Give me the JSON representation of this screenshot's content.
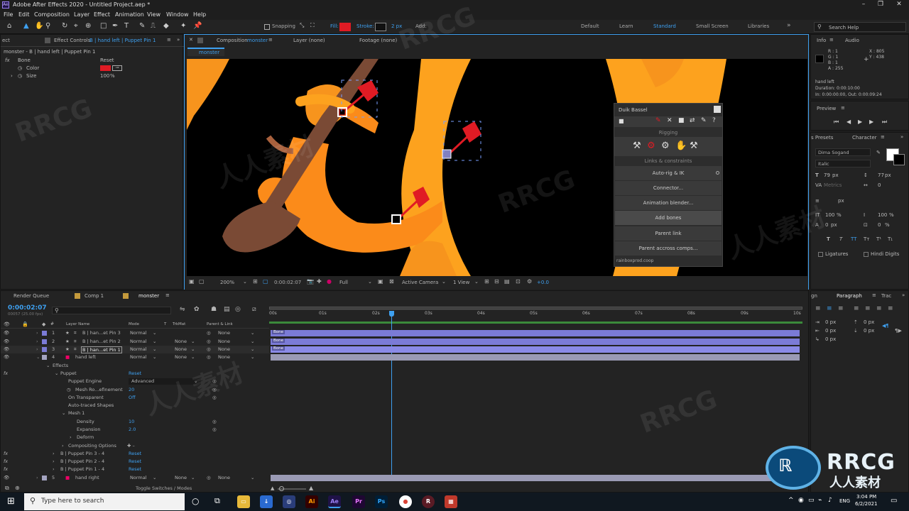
{
  "app": {
    "title": "Adobe After Effects 2020 - Untitled Project.aep *"
  },
  "menu": [
    "File",
    "Edit",
    "Composition",
    "Layer",
    "Effect",
    "Animation",
    "View",
    "Window",
    "Help"
  ],
  "toolbar": {
    "snapping": "Snapping",
    "fill": "Fill:",
    "stroke": "Stroke:",
    "stroke_px": "2 px",
    "add": "Add:",
    "workspaces": [
      "Default",
      "Learn",
      "Standard",
      "Small Screen",
      "Libraries"
    ],
    "search": "Search Help",
    "fill_color": "#e01b24"
  },
  "effect_controls": {
    "tab_prefix": "ect",
    "tab": "Effect Controls",
    "tab_layer": "B | hand left | Puppet Pin 1",
    "path": "monster - B | hand left | Puppet Pin 1",
    "fx": "fx",
    "effect_name": "Bone",
    "reset": "Reset",
    "color_label": "Color",
    "size_label": "Size",
    "size_value": "100",
    "size_unit": "%",
    "bone_color": "#e01b24"
  },
  "comp_panel": {
    "tab": "Composition",
    "tab_name": "monster",
    "layer_tab": "Layer (none)",
    "footage_tab": "Footage (none)",
    "crumb": "monster",
    "zoom": "200%",
    "time": "0:00:02:07",
    "resolution": "Full",
    "camera": "Active Camera",
    "view": "1 View",
    "exposure": "+0.0"
  },
  "duik": {
    "title": "Duik Bassel",
    "section1": "Rigging",
    "section2": "Links & constraints",
    "buttons": [
      "Auto-rig & IK",
      "Connector...",
      "Animation blender...",
      "Add bones",
      "Parent link",
      "Parent accross comps..."
    ],
    "footer": "rainboxprod.coop"
  },
  "info": {
    "tab": "Info",
    "audio": "Audio",
    "r": "R : 1",
    "g": "G : 1",
    "b": "B : 1",
    "a": "A : 255",
    "x": "X : 805",
    "y": "Y : 438",
    "layer": "hand left",
    "duration": "Duration: 0:00:10:00",
    "inout": "In: 0:00:00:00, Out: 0:00:09:24"
  },
  "preview": {
    "tab": "Preview"
  },
  "character": {
    "presets_tab": "s Presets",
    "tab": "Character",
    "font": "Dima Sogand",
    "style": "Italic",
    "size": "79",
    "size_unit": "px",
    "leading": "77",
    "leading_unit": "px",
    "tracking": "0",
    "kerning_label": "Metrics",
    "stroke_unit": "px",
    "vscale": "100",
    "vscale_unit": "%",
    "hscale": "100",
    "hscale_unit": "%",
    "baseline": "0",
    "baseline_unit": "px",
    "tsume": "0",
    "tsume_unit": "%",
    "ligatures": "Ligatures",
    "hindi": "Hindi Digits"
  },
  "paragraph": {
    "tab_prefix": "gn",
    "tab": "Paragraph",
    "tab2": "Trac",
    "indents": [
      "0 px",
      "0 px",
      "0 px",
      "0 px",
      "0 px"
    ]
  },
  "timeline": {
    "tabs": [
      "Render Queue",
      "Comp 1",
      "monster"
    ],
    "timecode": "0:00:02:07",
    "fps": "00057 (25.00 fps)",
    "ruler": [
      "00s",
      "01s",
      "02s",
      "03s",
      "04s",
      "05s",
      "06s",
      "07s",
      "08s",
      "09s",
      "10s"
    ],
    "col_headers": {
      "layer_name": "Layer Name",
      "mode": "Mode",
      "t": "T",
      "trkmat": "TrkMat",
      "parent": "Parent & Link"
    },
    "toggle": "Toggle Switches / Modes",
    "bone_label": "Bone",
    "layers": [
      {
        "num": "1",
        "name": "B | han...et Pin 3",
        "mode": "Normal",
        "trkmat": "",
        "parent": "None"
      },
      {
        "num": "2",
        "name": "B | han...et Pin 2",
        "mode": "Normal",
        "trkmat": "None",
        "parent": "None"
      },
      {
        "num": "3",
        "name": "B | han...et Pin 1",
        "mode": "Normal",
        "trkmat": "None",
        "parent": "None"
      },
      {
        "num": "4",
        "name": "hand left",
        "mode": "Normal",
        "trkmat": "None",
        "parent": "None"
      }
    ],
    "props": {
      "effects": "Effects",
      "puppet": "Puppet",
      "reset": "Reset",
      "engine_label": "Puppet Engine",
      "engine_value": "Advanced",
      "mesh_ref_label": "Mesh Ro...efinement",
      "mesh_ref_value": "20",
      "on_transparent": "On Transparent",
      "on_transparent_value": "Off",
      "auto_traced": "Auto-traced Shapes",
      "mesh1": "Mesh 1",
      "density": "Density",
      "density_value": "10",
      "expansion": "Expansion",
      "expansion_value": "2.0",
      "deform": "Deform",
      "compositing": "Compositing Options",
      "pins": [
        "B | Puppet Pin 3 - 4",
        "B | Puppet Pin 2 - 4",
        "B | Puppet Pin 1 - 4"
      ]
    },
    "layer5": {
      "num": "5",
      "name": "hand right",
      "mode": "Normal",
      "trkmat": "None",
      "parent": "None"
    }
  },
  "taskbar": {
    "search": "Type here to search",
    "lang": "ENG",
    "time": "3:04 PM",
    "date": "6/2/2021"
  },
  "watermark": {
    "logo": "RRCG",
    "sub": "人人素材",
    "marks": [
      "RRCG",
      "人人素材"
    ]
  }
}
